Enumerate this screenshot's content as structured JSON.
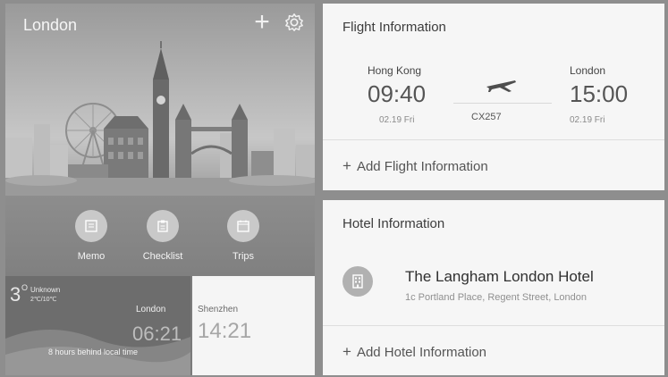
{
  "header": {
    "city": "London"
  },
  "tools": [
    {
      "label": "Memo",
      "icon": "memo-icon"
    },
    {
      "label": "Checklist",
      "icon": "checklist-icon"
    },
    {
      "label": "Trips",
      "icon": "trips-icon"
    }
  ],
  "weather": {
    "temp": "3",
    "deg": "O",
    "condition": "Unknown",
    "range": "2℃/10℃",
    "city": "London",
    "time": "06:21",
    "note": "8 hours behind local time"
  },
  "world_clock": {
    "city": "Shenzhen",
    "time": "14:21"
  },
  "flight": {
    "title": "Flight Information",
    "from": {
      "city": "Hong Kong",
      "time": "09:40",
      "date": "02.19  Fri"
    },
    "to": {
      "city": "London",
      "time": "15:00",
      "date": "02.19  Fri"
    },
    "number": "CX257",
    "add_label": "Add Flight Information",
    "add_plus": "+"
  },
  "hotel": {
    "title": "Hotel Information",
    "name": "The Langham London Hotel",
    "address": "1c Portland Place, Regent Street, London",
    "add_label": "Add Hotel Information",
    "add_plus": "+"
  },
  "plus_symbol": "+"
}
